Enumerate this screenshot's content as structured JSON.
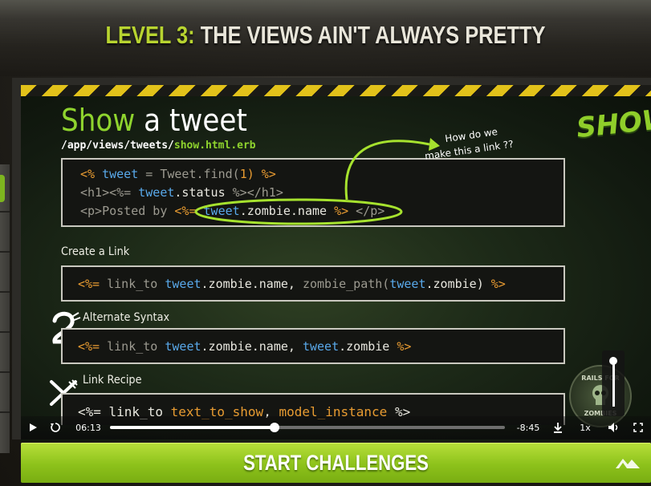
{
  "header": {
    "level_prefix": "LEVEL 3:",
    "level_name": " THE VIEWS AIN'T ALWAYS PRETTY"
  },
  "slide": {
    "title_highlight": "Show",
    "title_rest": " a tweet",
    "path_prefix": "/app/views/tweets/",
    "path_file": "show.html.erb",
    "annotation_line1": "How do we",
    "annotation_line2": "make this a link ??",
    "code_block_1": {
      "line1": {
        "open": "<% ",
        "var": "tweet",
        "mid": " = Tweet.find(",
        "num": "1",
        "close": ") %>"
      },
      "line2": {
        "open": "<h1><%= ",
        "var": "tweet",
        "mid": ".status ",
        "close": "%></h1>"
      },
      "line3": {
        "open": "<p>Posted by ",
        "erb": "<%= ",
        "var": "tweet",
        "mid": ".zombie.name ",
        "close": "%>",
        "tail": " </p>"
      }
    },
    "create_link_label": "Create a Link",
    "code_block_2": {
      "open": "<%= ",
      "fn": "link_to ",
      "var1": "tweet",
      "mid1": ".zombie.name, ",
      "fn2": "zombie_path(",
      "var2": "tweet",
      "mid2": ".zombie) ",
      "close": "%>"
    },
    "alternate_label": "Alternate Syntax",
    "code_block_3": {
      "open": "<%= ",
      "fn": "link_to ",
      "var1": "tweet",
      "mid1": ".zombie.name, ",
      "var2": "tweet",
      "mid2": ".zombie ",
      "close": "%>"
    },
    "recipe_label": "Link Recipe",
    "code_block_4": {
      "open": "<%= ",
      "fn": "link_to ",
      "arg1": "text_to_show",
      "sep": ", ",
      "arg2": "model_instance",
      "close": " %>"
    },
    "show_logo": "SHOW",
    "badge_top": "RAILS FOR",
    "badge_bottom": "ZOMBIES"
  },
  "player": {
    "current_time": "06:13",
    "remaining_time": "-8:45",
    "speed": "1x",
    "progress": 0.416,
    "volume": 1.0,
    "icons": [
      "play-icon",
      "replay-icon",
      "download-icon",
      "volume-icon",
      "fullscreen-icon"
    ]
  },
  "cta": {
    "label": "START CHALLENGES",
    "icon": "mountain-icon"
  },
  "colors": {
    "accent_green": "#8dc21b",
    "code_orange": "#e89b31",
    "code_blue": "#59a9ea",
    "hazard_yellow": "#e2c21a"
  }
}
